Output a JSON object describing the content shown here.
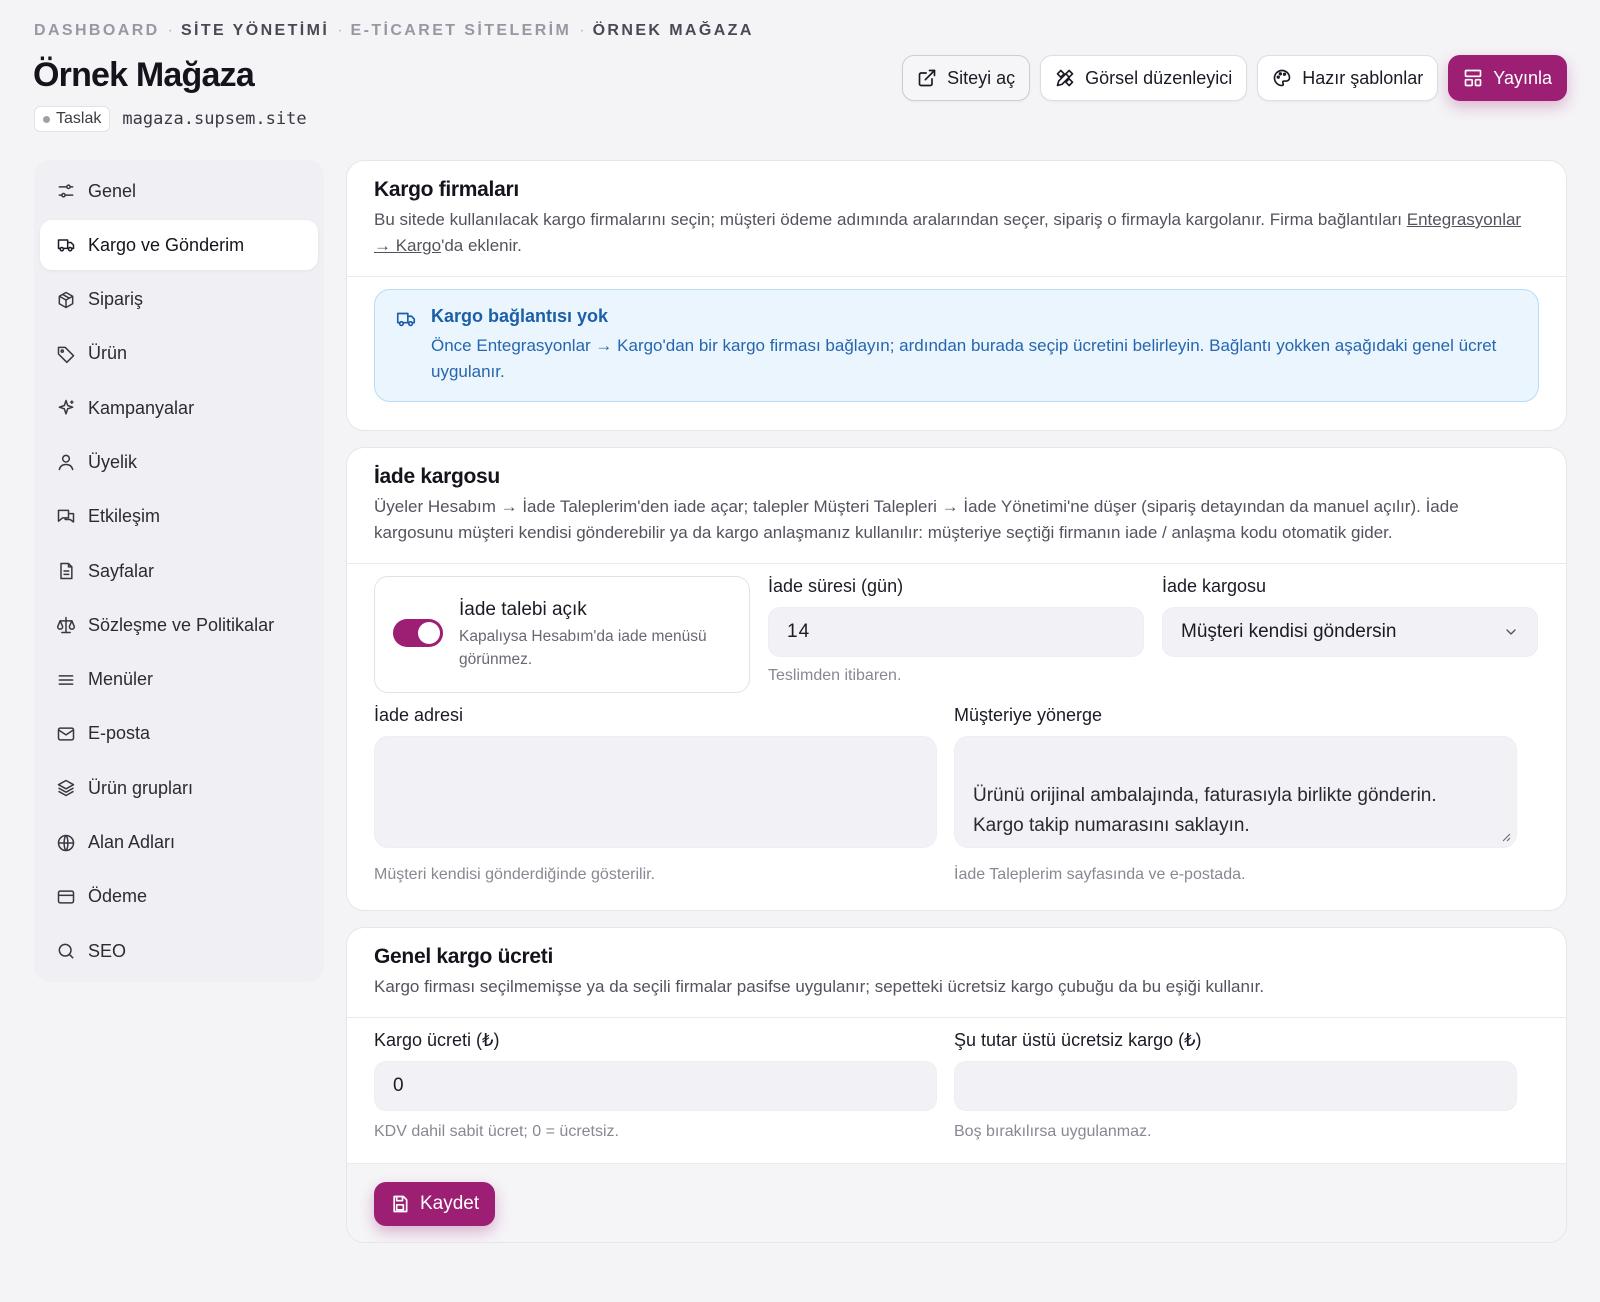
{
  "breadcrumb": [
    "DASHBOARD",
    "SİTE YÖNETİMİ",
    "E-TİCARET SİTELERİM",
    "ÖRNEK MAĞAZA"
  ],
  "page_title": "Örnek Mağaza",
  "status_badge": "Taslak",
  "domain": "magaza.supsem.site",
  "header_actions": {
    "open_site": "Siteyi aç",
    "visual_editor": "Görsel düzenleyici",
    "templates": "Hazır şablonlar",
    "publish": "Yayınla"
  },
  "sidebar": [
    {
      "label": "Genel",
      "icon": "sliders-icon"
    },
    {
      "label": "Kargo ve Gönderim",
      "icon": "truck-icon",
      "active": true
    },
    {
      "label": "Sipariş",
      "icon": "package-icon"
    },
    {
      "label": "Ürün",
      "icon": "tag-icon"
    },
    {
      "label": "Kampanyalar",
      "icon": "sparkles-icon"
    },
    {
      "label": "Üyelik",
      "icon": "user-icon"
    },
    {
      "label": "Etkileşim",
      "icon": "messages-icon"
    },
    {
      "label": "Sayfalar",
      "icon": "file-icon"
    },
    {
      "label": "Sözleşme ve Politikalar",
      "icon": "scale-icon"
    },
    {
      "label": "Menüler",
      "icon": "menu-icon"
    },
    {
      "label": "E-posta",
      "icon": "mail-icon"
    },
    {
      "label": "Ürün grupları",
      "icon": "layers-icon"
    },
    {
      "label": "Alan Adları",
      "icon": "globe-icon"
    },
    {
      "label": "Ödeme",
      "icon": "credit-card-icon"
    },
    {
      "label": "SEO",
      "icon": "search-icon"
    }
  ],
  "cargo_companies": {
    "title": "Kargo firmaları",
    "desc_before": "Bu sitede kullanılacak kargo firmalarını seçin; müşteri ödeme adımında aralarından seçer, sipariş o firmayla kargolanır. Firma bağlantıları ",
    "desc_link": "Entegrasyonlar → Kargo",
    "desc_after": "'da eklenir.",
    "alert_title": "Kargo bağlantısı yok",
    "alert_text": "Önce Entegrasyonlar → Kargo'dan bir kargo firması bağlayın; ardından burada seçip ücretini belirleyin. Bağlantı yokken aşağıdaki genel ücret uygulanır."
  },
  "returns": {
    "title": "İade kargosu",
    "desc": "Üyeler Hesabım → İade Taleplerim'den iade açar; talepler Müşteri Talepleri → İade Yönetimi'ne düşer (sipariş detayından da manuel açılır). İade kargosunu müşteri kendisi gönderebilir ya da kargo anlaşmanız kullanılır: müşteriye seçtiği firmanın iade / anlaşma kodu otomatik gider.",
    "toggle_title": "İade talebi açık",
    "toggle_desc": "Kapalıysa Hesabım'da iade menüsü görünmez.",
    "toggle_on": true,
    "period_label": "İade süresi (gün)",
    "period_value": "14",
    "period_hint": "Teslimden itibaren.",
    "carrier_label": "İade kargosu",
    "carrier_value": "Müşteri kendisi göndersin",
    "address_label": "İade adresi",
    "address_value": "",
    "address_hint": "Müşteri kendisi gönderdiğinde gösterilir.",
    "instructions_label": "Müşteriye yönerge",
    "instructions_value": "Ürünü orijinal ambalajında, faturasıyla birlikte gönderin.\nKargo takip numarasını saklayın.",
    "instructions_hint": "İade Taleplerim sayfasında ve e-postada."
  },
  "general_fee": {
    "title": "Genel kargo ücreti",
    "desc": "Kargo firması seçilmemişse ya da seçili firmalar pasifse uygulanır; sepetteki ücretsiz kargo çubuğu da bu eşiği kullanır.",
    "fee_label": "Kargo ücreti (₺)",
    "fee_value": "0",
    "fee_hint": "KDV dahil sabit ücret; 0 = ücretsiz.",
    "free_label": "Şu tutar üstü ücretsiz kargo (₺)",
    "free_value": "",
    "free_hint": "Boş bırakılırsa uygulanmaz."
  },
  "save_label": "Kaydet",
  "colors": {
    "accent": "#9c1f74",
    "info_bg": "#eaf5fd",
    "info_text": "#1c5ea8"
  }
}
